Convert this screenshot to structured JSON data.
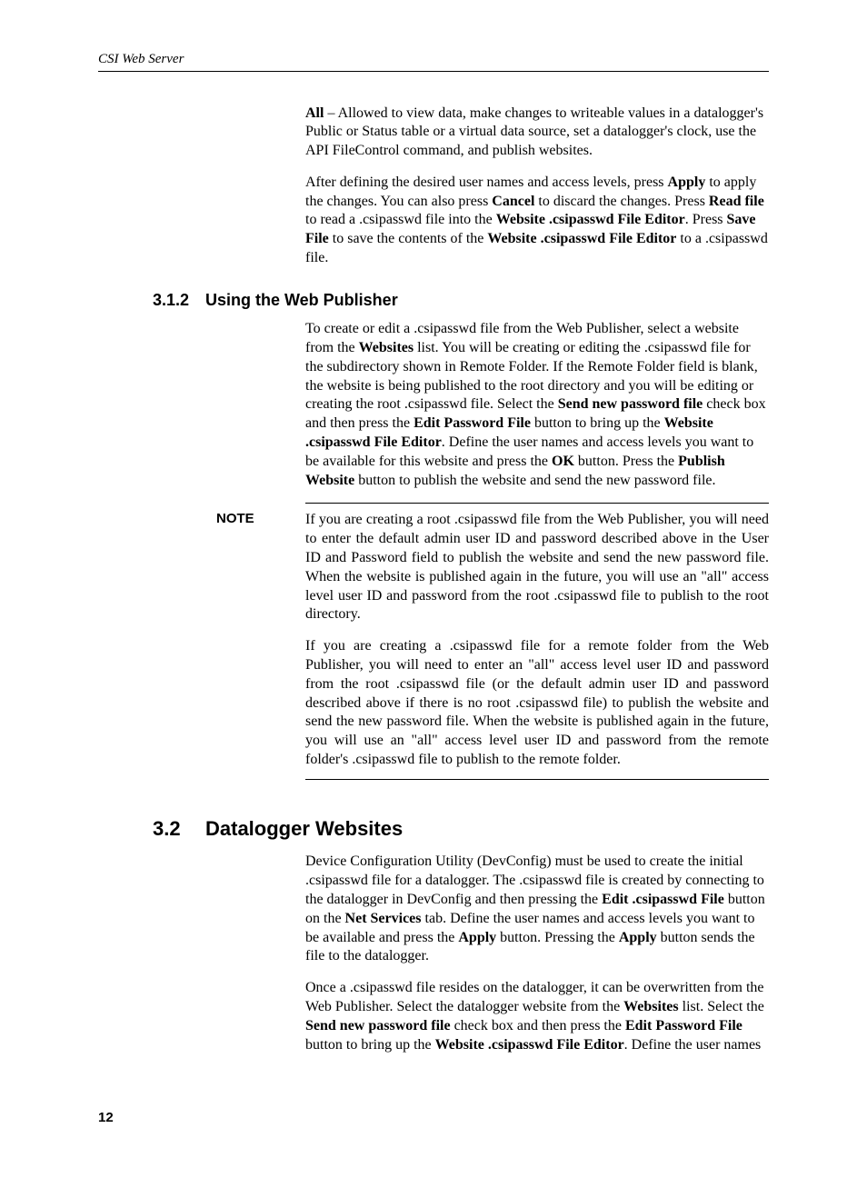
{
  "header": {
    "running": "CSI Web Server"
  },
  "para_all": {
    "lead": "All",
    "rest": " – Allowed to view data, make changes to writeable values in a datalogger's Public or Status table or a virtual data source, set a datalogger's clock, use the API FileControl command, and publish websites."
  },
  "para_after": {
    "t1": "After defining the desired user names and access levels, press ",
    "b1": "Apply",
    "t2": " to apply the changes.  You can also press ",
    "b2": "Cancel",
    "t3": " to discard the changes. Press ",
    "b3": "Read file",
    "t4": " to read a .csipasswd file into the ",
    "b4": "Website .csipasswd File Editor",
    "t5": ".  Press ",
    "b5": "Save File",
    "t6": " to save the contents of the ",
    "b6": "Website .csipasswd File Editor",
    "t7": " to a .csipasswd file."
  },
  "h312": {
    "num": "3.1.2",
    "title": "Using the Web Publisher"
  },
  "para_wp": {
    "t1": "To create or edit a .csipasswd file from the Web Publisher, select a website from the ",
    "b1": "Websites",
    "t2": " list. You will be creating or editing the .csipasswd file for the subdirectory shown in Remote Folder. If the Remote Folder field is blank, the website is being published to the root directory and you will be editing or creating the root .csipasswd file. Select the ",
    "b2": "Send new password file",
    "t3": " check box and then press the ",
    "b3": "Edit Password File",
    "t4": " button to bring up the ",
    "b4": "Website .csipasswd File Editor",
    "t5": ". Define the user names and access levels you want to be available for this website and press the ",
    "b5": "OK",
    "t6": " button. Press the ",
    "b6": "Publish Website",
    "t7": " button to publish the website and send the new password file."
  },
  "note": {
    "label": "NOTE",
    "p1": "If you are creating a root .csipasswd file from the Web Publisher, you will need to enter the default admin user ID and password described above in the User ID and Password field to publish the website and send the new password file. When the website is published again in the future, you will use an \"all\" access level user ID and password from the root .csipasswd file to publish to the root directory.",
    "p2": "If you are creating a .csipasswd file for a remote folder from the Web Publisher, you will need to enter an \"all\" access level user ID and password from the root .csipasswd file (or the default admin user ID and password described above if there is no root .csipasswd file) to publish the website and send the new password file.  When the website is published again in the future, you will use an \"all\" access level user ID and password from the remote folder's .csipasswd file to publish to the remote folder."
  },
  "h32": {
    "num": "3.2",
    "title": "Datalogger Websites"
  },
  "para_dw1": {
    "t1": "Device Configuration Utility (DevConfig) must be used to create the initial .csipasswd file for a datalogger. The .csipasswd file is created by connecting to the datalogger in DevConfig and then pressing the ",
    "b1": "Edit .csipasswd File",
    "t2": " button on the ",
    "b2": "Net Services",
    "t3": " tab. Define the user names and access levels you want to be available and press the ",
    "b3": "Apply",
    "t4": " button. Pressing the ",
    "b4": "Apply",
    "t5": " button sends the file to the datalogger."
  },
  "para_dw2": {
    "t1": "Once a .csipasswd file resides on the datalogger, it can be overwritten from the Web Publisher.  Select the datalogger website from the ",
    "b1": "Websites",
    "t2": " list. Select the ",
    "b2": "Send new password file",
    "t3": " check box and then press the ",
    "b3": "Edit Password File",
    "t4": " button to bring up the ",
    "b4": "Website .csipasswd File Editor",
    "t5": ". Define the user names"
  },
  "pagenum": "12"
}
